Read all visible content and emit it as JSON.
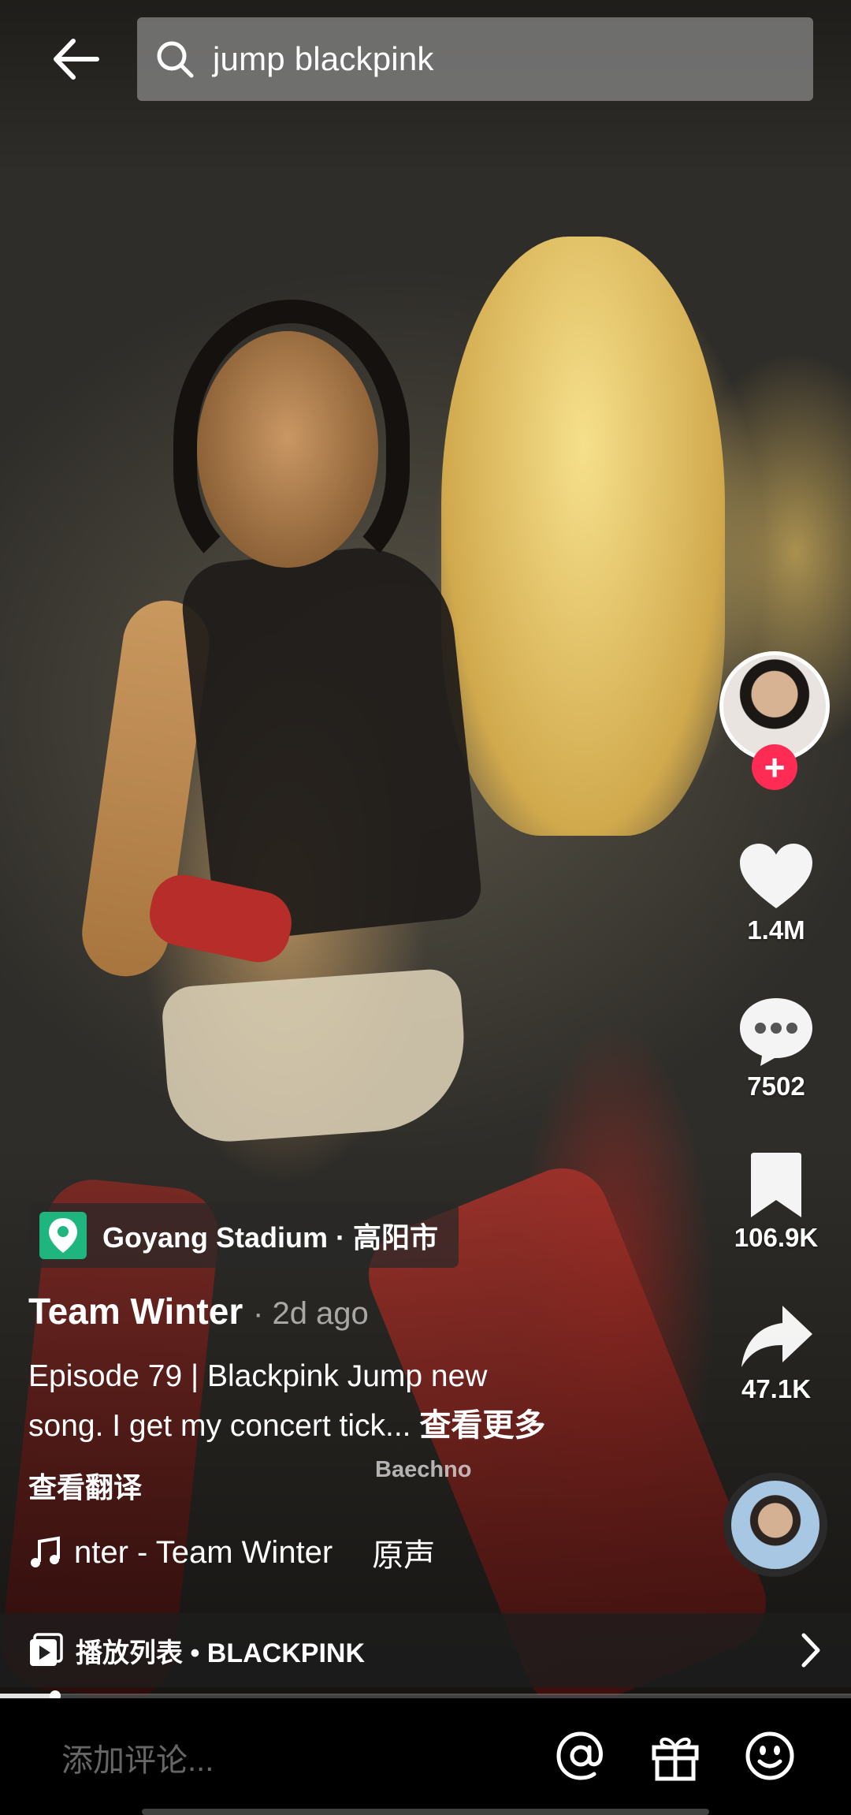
{
  "header": {
    "search_query": "jump blackpink"
  },
  "video": {
    "watermark": "Baechno"
  },
  "actions": {
    "likes": "1.4M",
    "comments": "7502",
    "favorites": "106.9K",
    "shares": "47.1K"
  },
  "post": {
    "location": "Goyang Stadium · 高阳市",
    "author": "Team Winter",
    "time": "· 2d ago",
    "description_line1": "Episode 79 | Blackpink Jump new",
    "description_line2": "song. I get my concert tick...",
    "see_more": "查看更多",
    "translate": "查看翻译",
    "music_title": "nter - Team Winter",
    "music_original": "原声"
  },
  "playlist": {
    "label": "播放列表 • BLACKPINK"
  },
  "progress": {
    "fraction": 0.065
  },
  "comment": {
    "placeholder": "添加评论..."
  },
  "colors": {
    "follow_red": "#fe2c55",
    "location_green": "#1fb57e"
  },
  "icons": [
    "back-arrow-icon",
    "search-icon",
    "heart-icon",
    "comment-icon",
    "bookmark-icon",
    "share-icon",
    "location-pin-icon",
    "music-note-icon",
    "playlist-icon",
    "chevron-right-icon",
    "at-icon",
    "gift-icon",
    "emoji-icon"
  ]
}
